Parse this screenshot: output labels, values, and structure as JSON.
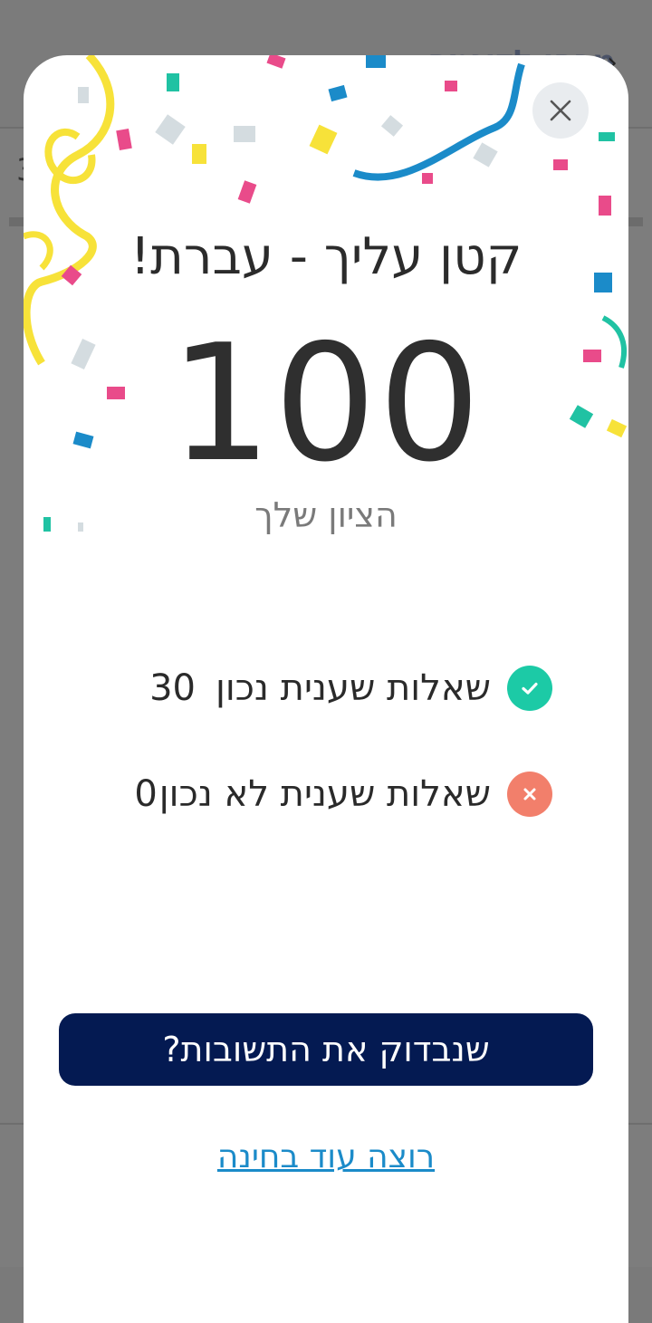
{
  "background": {
    "header_title": "מבחן לדוגמה",
    "counter": "3"
  },
  "modal": {
    "title": "קטן עליך - עברת!",
    "score": "100",
    "score_label": "הציון שלך",
    "stats": [
      {
        "label": "שאלות שענית נכון",
        "value": "30",
        "icon": "check-icon",
        "color": "#1ccaa6"
      },
      {
        "label": "שאלות שענית לא נכון",
        "value": "0",
        "icon": "x-icon",
        "color": "#f27f6b"
      }
    ],
    "primary_button": "שנבדוק את התשובות?",
    "secondary_link": "רוצה עוד בחינה"
  },
  "colors": {
    "primary": "#041a52",
    "link": "#1b8bc9",
    "success": "#1ccaa6",
    "error": "#f27f6b"
  }
}
